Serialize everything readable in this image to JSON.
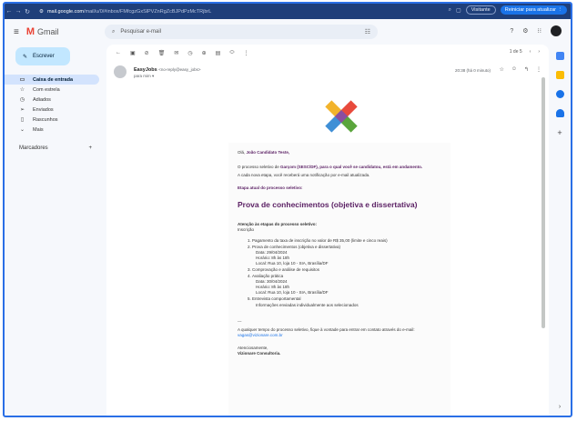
{
  "browser": {
    "url_host": "mail.google.com",
    "url_path": "/mail/u/0/#inbox/FMfcgzGxSlPVZnRgZcBJPdPzMcTRjbrL",
    "visitor_label": "Visitante",
    "update_label": "Reiniciar para atualizar"
  },
  "gmail": {
    "app_name": "Gmail",
    "search_placeholder": "Pesquisar e-mail"
  },
  "sidebar": {
    "compose_label": "Escrever",
    "items": [
      {
        "icon": "inbox-icon",
        "label": "Caixa de entrada",
        "active": true
      },
      {
        "icon": "star-icon",
        "label": "Com estrela",
        "active": false
      },
      {
        "icon": "clock-icon",
        "label": "Adiados",
        "active": false
      },
      {
        "icon": "send-icon",
        "label": "Enviados",
        "active": false
      },
      {
        "icon": "draft-icon",
        "label": "Rascunhos",
        "active": false
      },
      {
        "icon": "chevron-down-icon",
        "label": "Mais",
        "active": false
      }
    ],
    "labels_title": "Marcadores",
    "labels_add": "+"
  },
  "toolbar": {
    "pager": "1 de 5"
  },
  "message": {
    "sender_name": "EasyJobs",
    "sender_email": "<no-reply@easy_jobs>",
    "to": "para mim",
    "date": "20:38 (há 0 minuto)"
  },
  "email": {
    "greeting_prefix": "Olá, ",
    "greeting_name": "João Candidato Teste,",
    "intro_prefix": "O processo seletivo de ",
    "intro_company": "Garçom (SESC/DF), para o qual você se candidatou, está em andamento.",
    "intro_note": "A cada nova etapa, você receberá uma notificação por e-mail atualizada.",
    "stage_label": "Etapa atual do processo seletivo:",
    "stage_title": "Prova de conhecimentos (objetiva e dissertativa)",
    "attention": "Atenção às etapas do processo seletivo:",
    "inscricao": "Inscrição",
    "steps": [
      {
        "text": "Pagamento da taxa de inscrição no valor de R$ 35,00 (limite e cinco reais)",
        "sub": []
      },
      {
        "text": "Prova de conhecimentos (objetiva e dissertativa)",
        "sub": [
          "Data: 29/04/2024",
          "Horário: 8h às 18h",
          "Local: Rua 10, loja 10 - SIA, Brasília/DF"
        ]
      },
      {
        "text": "Comprovação e análise de requisitos",
        "sub": []
      },
      {
        "text": "Avaliação prática",
        "sub": [
          "Data: 30/04/2024",
          "Horário: 8h às 18h",
          "Local: Rua 10, loja 10 - SIA, Brasília/DF"
        ]
      },
      {
        "text": "Entrevista comportamental",
        "sub": [
          "Informações enviadas individualmente aos selecionados"
        ]
      }
    ],
    "dashes": "---",
    "contact_prefix": "A qualquer tempo do processo seletivo, fique à vontade para entrar em contato através do e-mail: ",
    "contact_email": "vagas@vizionare.com.br",
    "sign_off": "Atenciosamente,",
    "sign_company": "Vizionare Consultoria."
  },
  "colors": {
    "accent": "#5a1f63",
    "chrome": "#1f3f7a",
    "compose": "#c2e7ff",
    "active_nav": "#d3e3fd"
  }
}
